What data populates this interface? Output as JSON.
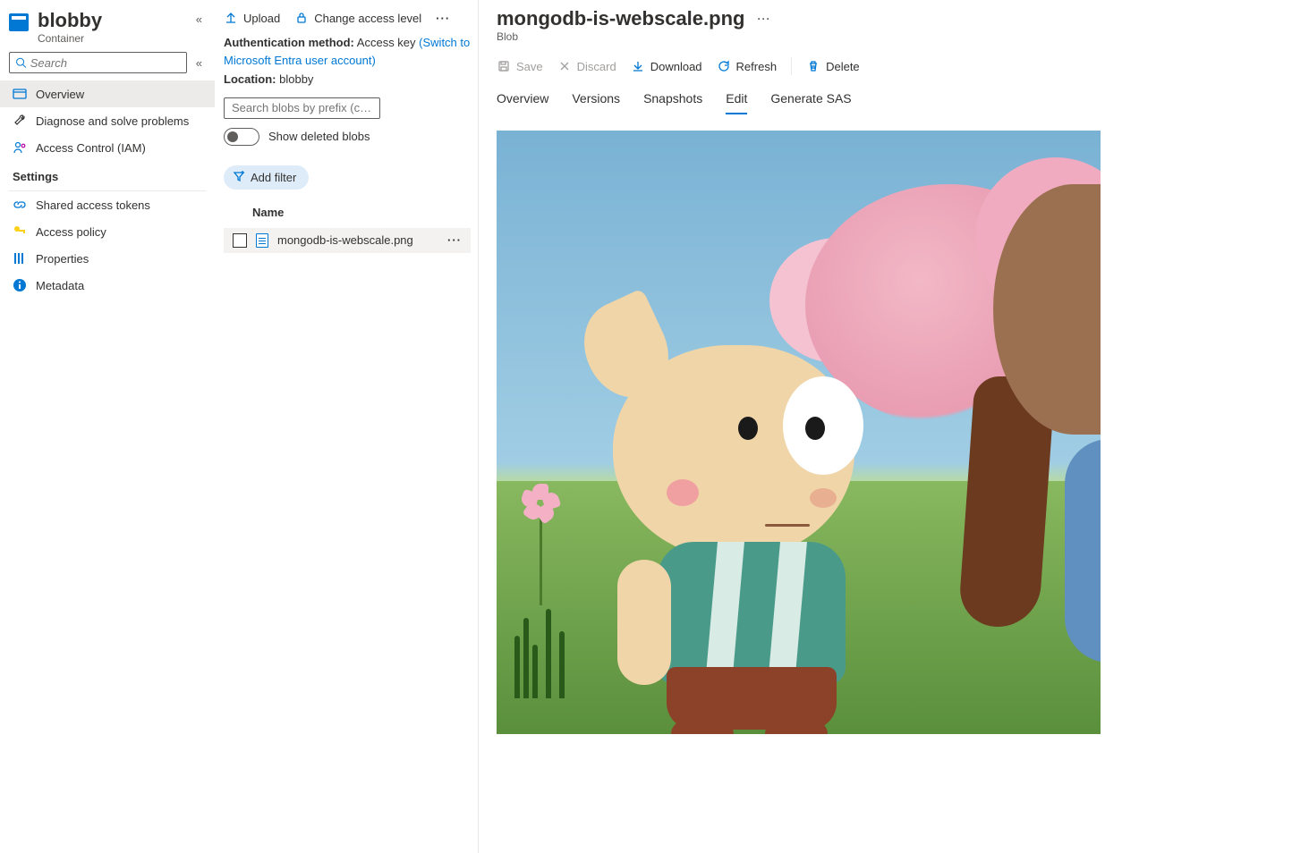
{
  "nav": {
    "title": "blobby",
    "subtitle": "Container",
    "search_placeholder": "Search",
    "items": [
      {
        "label": "Overview",
        "icon": "overview"
      },
      {
        "label": "Diagnose and solve problems",
        "icon": "wrench"
      },
      {
        "label": "Access Control (IAM)",
        "icon": "iam"
      }
    ],
    "settings_label": "Settings",
    "settings_items": [
      {
        "label": "Shared access tokens",
        "icon": "link"
      },
      {
        "label": "Access policy",
        "icon": "key"
      },
      {
        "label": "Properties",
        "icon": "props"
      },
      {
        "label": "Metadata",
        "icon": "info"
      }
    ]
  },
  "content": {
    "toolbar": {
      "upload": "Upload",
      "access_level": "Change access level",
      "auth_label": "Authentication method:",
      "auth_value": "Access key",
      "auth_link": "(Switch to Microsoft Entra user account)",
      "location_label": "Location:",
      "location_value": "blobby",
      "prefix_placeholder": "Search blobs by prefix (case-sensitive)",
      "show_deleted": "Show deleted blobs",
      "add_filter": "Add filter"
    },
    "list": {
      "header_name": "Name",
      "rows": [
        {
          "name": "mongodb-is-webscale.png"
        }
      ]
    }
  },
  "blob": {
    "title": "mongodb-is-webscale.png",
    "subtitle": "Blob",
    "toolbar": {
      "save": "Save",
      "discard": "Discard",
      "download": "Download",
      "refresh": "Refresh",
      "delete": "Delete"
    },
    "tabs": [
      "Overview",
      "Versions",
      "Snapshots",
      "Edit",
      "Generate SAS"
    ],
    "active_tab": "Edit"
  }
}
